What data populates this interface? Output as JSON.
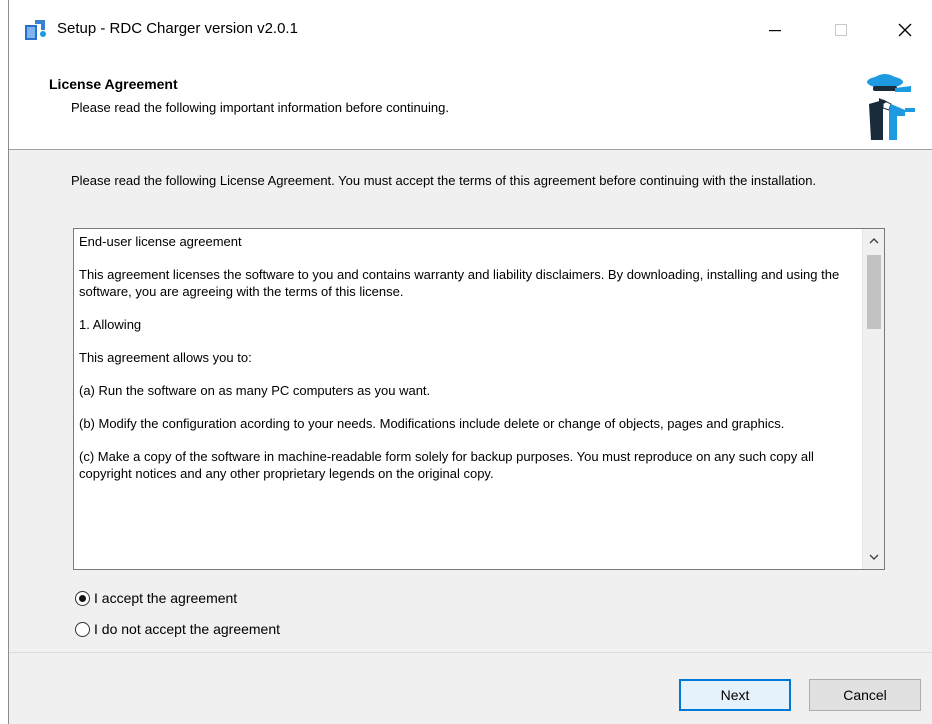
{
  "window": {
    "title": "Setup - RDC Charger version v2.0.1"
  },
  "header": {
    "title": "License Agreement",
    "subtitle": "Please read the following important information before continuing."
  },
  "body": {
    "intro": "Please read the following License Agreement. You must accept the terms of this agreement before continuing with the installation.",
    "license_paragraphs": [
      "End-user license agreement",
      "This agreement licenses the software to you and contains warranty and liability disclaimers. By downloading, installing and using the software, you are agreeing with the terms of this license.",
      "1. Allowing",
      "This agreement allows you to:",
      "(a) Run the software on as many PC computers as you want.",
      "(b) Modify the configuration acording to your needs. Modifications include delete or change of objects, pages and graphics.",
      "(c) Make a copy of the software in machine-readable form solely for backup purposes. You must reproduce on any such copy all copyright notices and any other proprietary legends on the original copy."
    ]
  },
  "options": {
    "accept_label": "I accept the agreement",
    "reject_label": "I do not accept the agreement",
    "selected": "accept"
  },
  "buttons": {
    "next": "Next",
    "cancel": "Cancel"
  },
  "icons": {
    "app": "installer-icon",
    "logo": "butler-logo-icon",
    "minimize": "minimize-icon",
    "maximize": "maximize-icon",
    "close": "close-icon",
    "scroll_up": "chevron-up-icon",
    "scroll_down": "chevron-down-icon"
  },
  "colors": {
    "accent": "#0078d7",
    "logo_blue": "#1e9be0",
    "logo_dark": "#1a2b3c"
  }
}
